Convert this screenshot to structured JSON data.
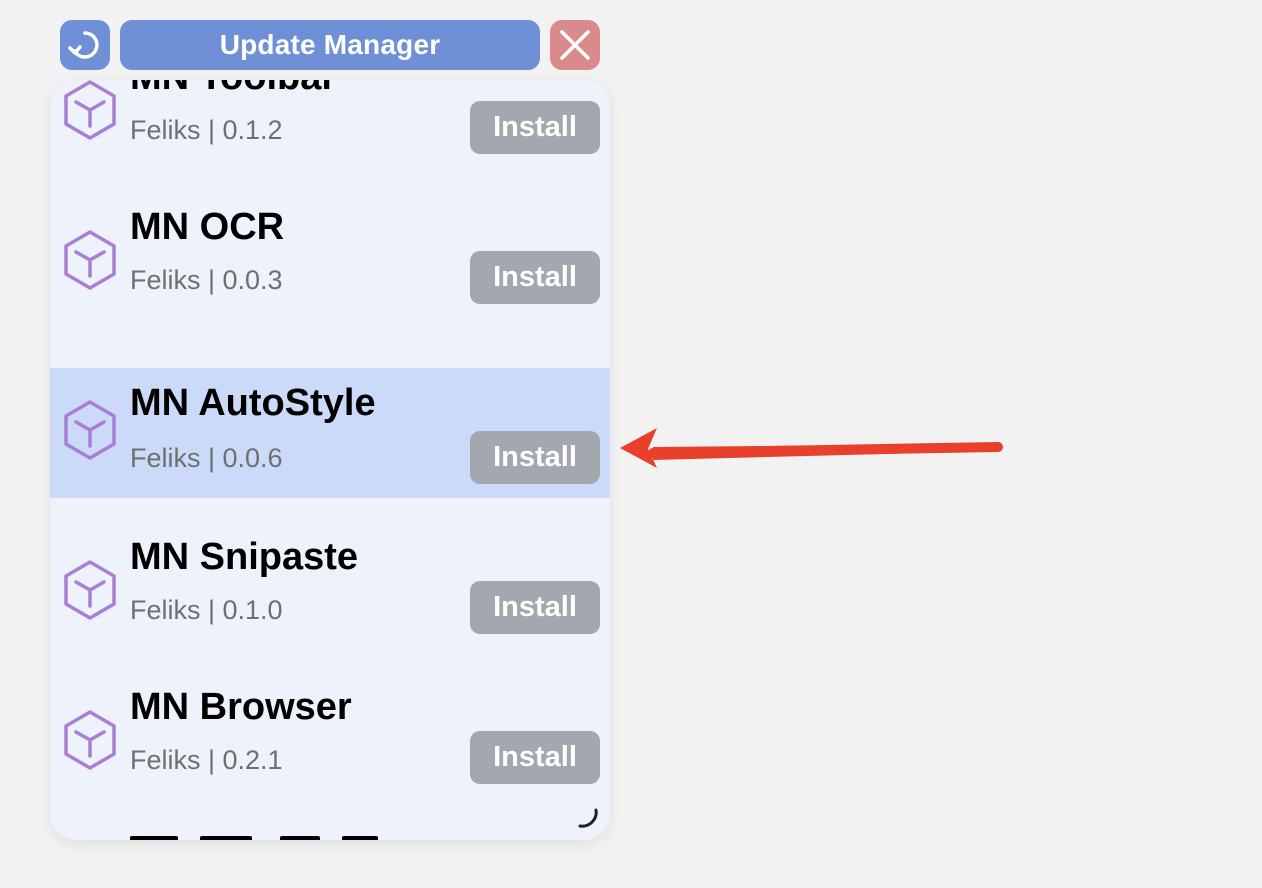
{
  "header": {
    "title": "Update Manager",
    "refresh_icon": "refresh-icon",
    "close_icon": "close-icon",
    "accent_color": "#6f8fd6",
    "close_color": "#d98b8b"
  },
  "items": [
    {
      "name": "MN Toolbar",
      "meta": "Feliks | 0.1.2",
      "button": "Install",
      "icon": "package-icon",
      "selected": false
    },
    {
      "name": "MN OCR",
      "meta": "Feliks | 0.0.3",
      "button": "Install",
      "icon": "package-icon",
      "selected": false
    },
    {
      "name": "MN AutoStyle",
      "meta": "Feliks | 0.0.6",
      "button": "Install",
      "icon": "package-icon",
      "selected": true
    },
    {
      "name": "MN Snipaste",
      "meta": "Feliks | 0.1.0",
      "button": "Install",
      "icon": "package-icon",
      "selected": false
    },
    {
      "name": "MN Browser",
      "meta": "Feliks | 0.2.1",
      "button": "Install",
      "icon": "package-icon",
      "selected": false
    }
  ],
  "colors": {
    "panel_bg": "#edf2fb",
    "selected_bg": "#cbdaf8",
    "install_bg": "#a2a8ae",
    "icon_stroke": "#a77fd6",
    "annotation_arrow": "#e8402a"
  }
}
